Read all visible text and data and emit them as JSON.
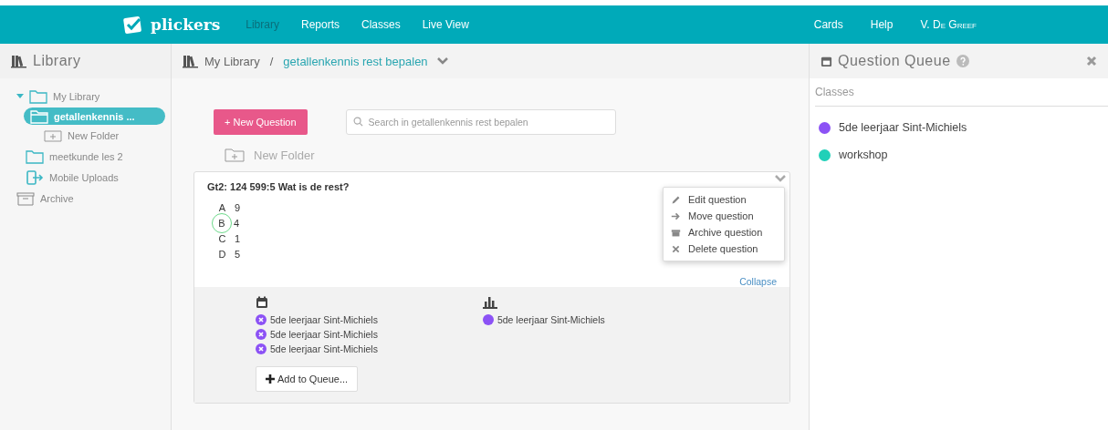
{
  "nav": {
    "logo": "plickers",
    "items": [
      {
        "label": "Library",
        "selected": true
      },
      {
        "label": "Reports",
        "selected": false
      },
      {
        "label": "Classes",
        "selected": false
      },
      {
        "label": "Live View",
        "selected": false
      }
    ],
    "right_items": [
      "Cards",
      "Help",
      "V. De Greef"
    ]
  },
  "sidebar": {
    "title": "Library",
    "tree": [
      {
        "label": "My Library",
        "kind": "folder",
        "expanded": true,
        "selected": false,
        "children": [
          {
            "label": "getallenkennis ...",
            "kind": "open-folder",
            "selected": true,
            "children": [
              {
                "label": "New Folder",
                "kind": "new-folder",
                "selected": false
              }
            ]
          },
          {
            "label": "meetkunde les 2",
            "kind": "folder",
            "selected": false
          },
          {
            "label": "Mobile Uploads",
            "kind": "mobile",
            "selected": false
          }
        ]
      },
      {
        "label": "Archive",
        "kind": "archive",
        "selected": false
      }
    ]
  },
  "breadcrumb": {
    "root": "My Library",
    "separator": "/",
    "current": "getallenkennis rest bepalen"
  },
  "toolbar": {
    "new_question": "+ New Question",
    "search": {
      "placeholder": "Search in getallenkennis rest bepalen"
    },
    "new_folder": "New Folder"
  },
  "question": {
    "title": "Gt2: 124 599:5 Wat is de rest?",
    "answers": [
      {
        "letter": "A",
        "text": "9",
        "correct": false
      },
      {
        "letter": "B",
        "text": "4",
        "correct": true
      },
      {
        "letter": "C",
        "text": "1",
        "correct": false
      },
      {
        "letter": "D",
        "text": "5",
        "correct": false
      }
    ],
    "menu": [
      {
        "kind": "edit",
        "label": "Edit question"
      },
      {
        "kind": "move",
        "label": "Move question"
      },
      {
        "kind": "archive",
        "label": "Archive question"
      },
      {
        "kind": "delete",
        "label": "Delete question"
      }
    ],
    "collapse": "Collapse",
    "queued": [
      {
        "name": "5de leerjaar Sint-Michiels",
        "color": "#8c52f5"
      },
      {
        "name": "5de leerjaar Sint-Michiels",
        "color": "#8c52f5"
      },
      {
        "name": "5de leerjaar Sint-Michiels",
        "color": "#8c52f5"
      }
    ],
    "reports": [
      {
        "name": "5de leerjaar Sint-Michiels",
        "color": "#8c52f5"
      }
    ],
    "add_to_queue": "Add to Queue..."
  },
  "queue_panel": {
    "title": "Question Queue",
    "section": "Classes",
    "classes": [
      {
        "name": "5de leerjaar Sint-Michiels",
        "color": "#8c52f5"
      },
      {
        "name": "workshop",
        "color": "#20d0b8"
      }
    ]
  }
}
